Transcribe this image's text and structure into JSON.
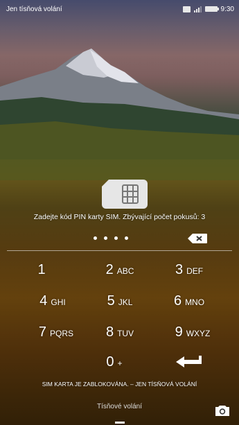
{
  "status_bar": {
    "carrier_text": "Jen tísňová volání",
    "time": "9:30",
    "icons": [
      "sim-status-icon",
      "signal-icon",
      "battery-icon"
    ]
  },
  "pin_entry": {
    "prompt": "Zadejte kód PIN karty SIM. Zbývající počet pokusů: 3",
    "entered_digits_count": 4,
    "masked_value": "••••",
    "backspace_icon": "backspace-icon"
  },
  "keypad": {
    "keys": [
      {
        "digit": "1",
        "letters": ""
      },
      {
        "digit": "2",
        "letters": "ABC"
      },
      {
        "digit": "3",
        "letters": "DEF"
      },
      {
        "digit": "4",
        "letters": "GHI"
      },
      {
        "digit": "5",
        "letters": "JKL"
      },
      {
        "digit": "6",
        "letters": "MNO"
      },
      {
        "digit": "7",
        "letters": "PQRS"
      },
      {
        "digit": "8",
        "letters": "TUV"
      },
      {
        "digit": "9",
        "letters": "WXYZ"
      },
      {
        "digit": "0",
        "letters": "+"
      }
    ],
    "enter_icon": "enter-arrow-icon"
  },
  "footer": {
    "sim_blocked_message": "SIM KARTA JE ZABLOKOVÁNA. – JEN TÍSŇOVÁ VOLÁNÍ",
    "emergency_call_label": "Tísňové volání",
    "camera_icon": "camera-icon"
  }
}
